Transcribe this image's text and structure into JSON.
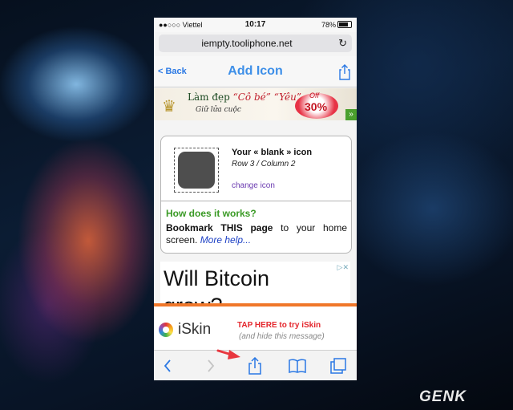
{
  "status_bar": {
    "carrier": "●●○○○ Viettel",
    "time": "10:17",
    "battery": "78%"
  },
  "browser": {
    "url": "iempty.tooliphone.net"
  },
  "navbar": {
    "back_label": "< Back",
    "title": "Add Icon"
  },
  "banner_ad": {
    "line1_a": "Làm đẹp",
    "line1_b": "“Cô bé” “Yêu”",
    "line2": "Giữ lửa cuộc",
    "off_label": "Off",
    "discount": "30%",
    "more": "»"
  },
  "card": {
    "icon_title": "Your « blank » icon",
    "position": "Row 3 / Column 2",
    "change_link": "change icon",
    "how_heading": "How does it works?",
    "desc_bold": "Bookmark THIS page",
    "desc_rest": " to your home screen. ",
    "more_help": "More help..."
  },
  "ad_block": {
    "headline": "Will Bitcoin",
    "headline2": "grow?",
    "adchoices": "▷✕"
  },
  "promo": {
    "app_name": "iSkin",
    "tap_text": "TAP HERE to try iSkin",
    "hide_text": "(and hide this message)"
  },
  "watermark": {
    "text": "GEN",
    "text2": "K"
  },
  "colors": {
    "accent": "#2a78e4",
    "promo_border": "#f0772a",
    "arrow": "#e8373f"
  }
}
